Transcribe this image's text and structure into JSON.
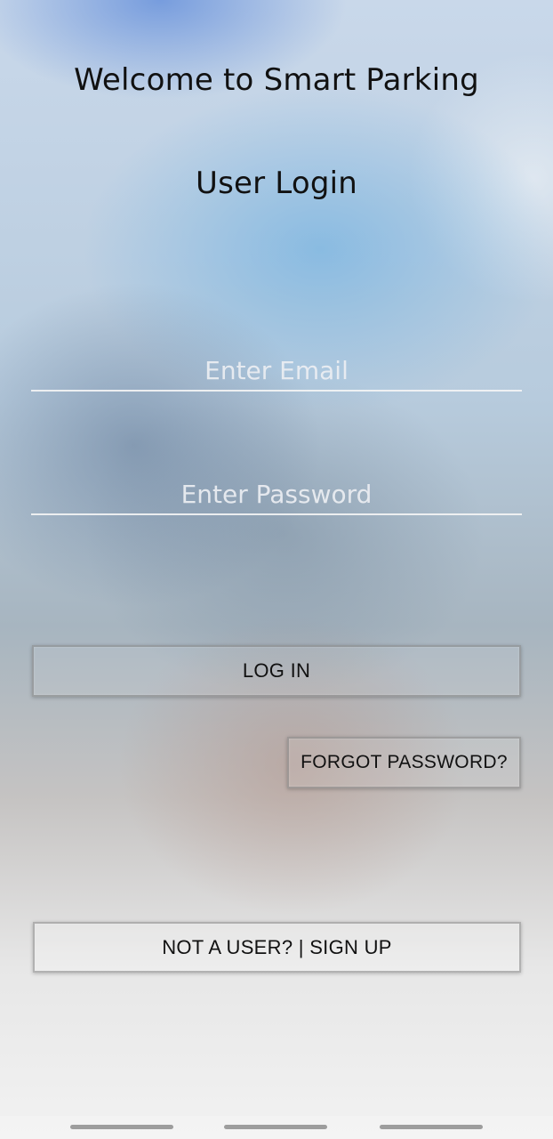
{
  "header": {
    "welcome_text": "Welcome to Smart Parking",
    "subtitle": "User Login"
  },
  "form": {
    "email_placeholder": "Enter Email",
    "password_placeholder": "Enter Password"
  },
  "buttons": {
    "login_label": "LOG IN",
    "forgot_label": "FORGOT PASSWORD?",
    "signup_label": "NOT A USER? | SIGN UP"
  },
  "system_nav": {
    "items": [
      "recent-apps-icon",
      "home-icon",
      "back-icon"
    ]
  },
  "colors": {
    "text": "#111111",
    "placeholder": "#EBEEF2",
    "underline": "#F5F5F5"
  }
}
